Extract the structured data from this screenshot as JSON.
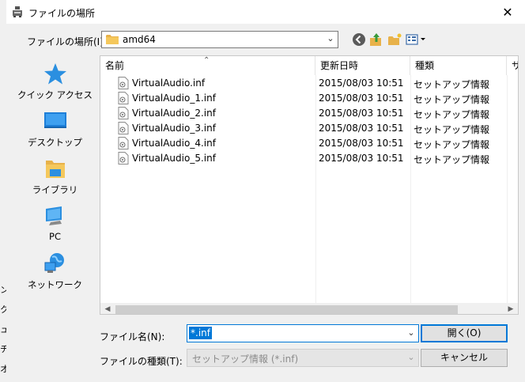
{
  "background_app": {
    "chars": [
      "ン",
      "ク",
      "ュ",
      "チ",
      "オ"
    ]
  },
  "window": {
    "title": "ファイルの場所",
    "close_label": "✕"
  },
  "location": {
    "label": "ファイルの場所(I):",
    "value": "amd64"
  },
  "toolbar": {
    "icons": [
      "back-icon",
      "up-folder-icon",
      "new-folder-icon",
      "view-menu-icon"
    ]
  },
  "places": [
    {
      "label": "クイック アクセス",
      "icon": "quick-access-star-icon"
    },
    {
      "label": "デスクトップ",
      "icon": "desktop-icon"
    },
    {
      "label": "ライブラリ",
      "icon": "library-icon"
    },
    {
      "label": "PC",
      "icon": "pc-icon"
    },
    {
      "label": "ネットワーク",
      "icon": "network-icon"
    }
  ],
  "columns": {
    "name": "名前",
    "date": "更新日時",
    "type": "種類",
    "size": "サ"
  },
  "files": [
    {
      "name": "VirtualAudio.inf",
      "date": "2015/08/03 10:51",
      "type": "セットアップ情報"
    },
    {
      "name": "VirtualAudio_1.inf",
      "date": "2015/08/03 10:51",
      "type": "セットアップ情報"
    },
    {
      "name": "VirtualAudio_2.inf",
      "date": "2015/08/03 10:51",
      "type": "セットアップ情報"
    },
    {
      "name": "VirtualAudio_3.inf",
      "date": "2015/08/03 10:51",
      "type": "セットアップ情報"
    },
    {
      "name": "VirtualAudio_4.inf",
      "date": "2015/08/03 10:51",
      "type": "セットアップ情報"
    },
    {
      "name": "VirtualAudio_5.inf",
      "date": "2015/08/03 10:51",
      "type": "セットアップ情報"
    }
  ],
  "filename": {
    "label": "ファイル名(N):",
    "value": "*.inf"
  },
  "filetype": {
    "label": "ファイルの種類(T):",
    "value": "セットアップ情報 (*.inf)"
  },
  "buttons": {
    "open": "開く(O)",
    "cancel": "キャンセル"
  },
  "colors": {
    "accent": "#0078d7",
    "folder": "#e8b24a",
    "dialog_bg": "#f0f0f0"
  }
}
